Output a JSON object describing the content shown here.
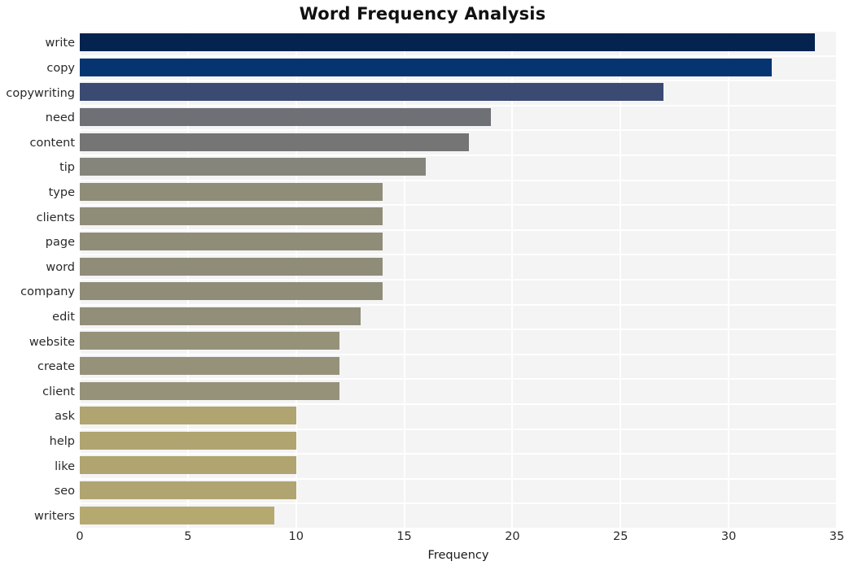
{
  "chart_data": {
    "type": "bar",
    "orientation": "horizontal",
    "title": "Word Frequency Analysis",
    "xlabel": "Frequency",
    "ylabel": "",
    "xlim": [
      0,
      35
    ],
    "ylim": null,
    "grid": true,
    "legend": null,
    "xticks": [
      0,
      5,
      10,
      15,
      20,
      25,
      30,
      35
    ],
    "xtick_labels": [
      "0",
      "5",
      "10",
      "15",
      "20",
      "25",
      "30",
      "35"
    ],
    "categories": [
      "write",
      "copy",
      "copywriting",
      "need",
      "content",
      "tip",
      "type",
      "clients",
      "page",
      "word",
      "company",
      "edit",
      "website",
      "create",
      "client",
      "ask",
      "help",
      "like",
      "seo",
      "writers"
    ],
    "values": [
      34,
      32,
      27,
      19,
      18,
      16,
      14,
      14,
      14,
      14,
      14,
      13,
      12,
      12,
      12,
      10,
      10,
      10,
      10,
      9
    ],
    "bar_colors": [
      "#04234f",
      "#053470",
      "#3a4a72",
      "#6e7075",
      "#757575",
      "#86857c",
      "#8f8c78",
      "#8f8c78",
      "#8f8c78",
      "#8f8c78",
      "#8f8c78",
      "#918e79",
      "#96927a",
      "#96927a",
      "#96927a",
      "#b0a470",
      "#b0a470",
      "#b0a470",
      "#b0a470",
      "#b5a96f"
    ],
    "plot_background": "#f4f4f5",
    "gridline_color": "#ffffff",
    "figure_background": "#ffffff"
  }
}
